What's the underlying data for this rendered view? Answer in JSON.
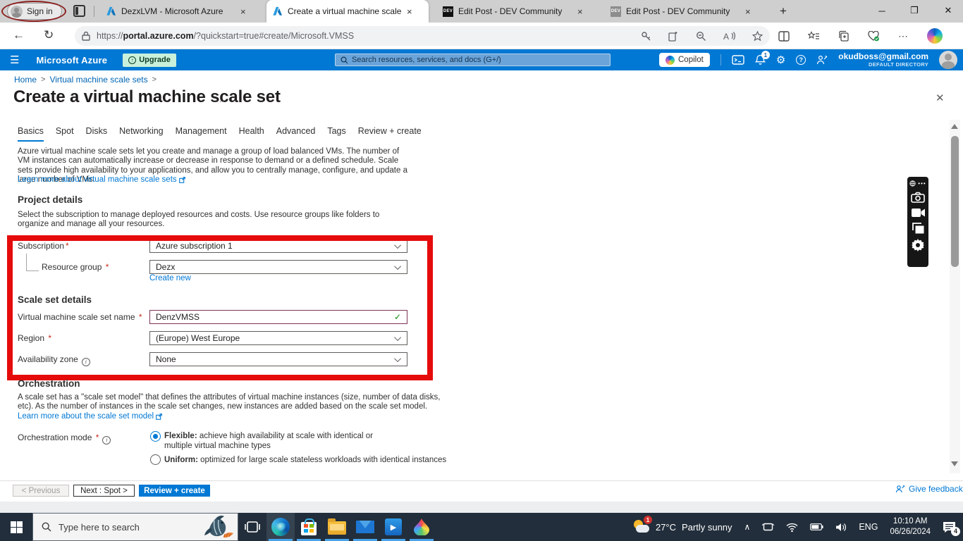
{
  "browser": {
    "sign_in_label": "Sign in",
    "tabs": [
      {
        "title": "DezxLVM - Microsoft Azure"
      },
      {
        "title": "Create a virtual machine scale se"
      },
      {
        "title": "Edit Post - DEV Community"
      },
      {
        "title": "Edit Post - DEV Community"
      }
    ],
    "dev_favicon_text": "DEV",
    "url_scheme": "https://",
    "url_host": "portal.azure.com",
    "url_path": "/?quickstart=true#create/Microsoft.VMSS"
  },
  "azure_header": {
    "brand": "Microsoft Azure",
    "upgrade_label": "Upgrade",
    "search_placeholder": "Search resources, services, and docs (G+/)",
    "copilot_label": "Copilot",
    "notification_count": "1",
    "account_email": "okudboss@gmail.com",
    "account_directory": "DEFAULT DIRECTORY"
  },
  "breadcrumb": {
    "home": "Home",
    "parent": "Virtual machine scale sets"
  },
  "page": {
    "title": "Create a virtual machine scale set",
    "tabs": [
      "Basics",
      "Spot",
      "Disks",
      "Networking",
      "Management",
      "Health",
      "Advanced",
      "Tags",
      "Review + create"
    ],
    "intro_text": "Azure virtual machine scale sets let you create and manage a group of load balanced VMs. The number of VM instances can automatically increase or decrease in response to demand or a defined schedule. Scale sets provide high availability to your applications, and allow you to centrally manage, configure, and update a large number of VMs.",
    "intro_link": "Learn more about virtual machine scale sets",
    "project_details_heading": "Project details",
    "project_details_text": "Select the subscription to manage deployed resources and costs. Use resource groups like folders to organize and manage all your resources.",
    "required_mark": "*",
    "fields": {
      "subscription_label": "Subscription",
      "subscription_value": "Azure subscription 1",
      "resource_group_label": "Resource group",
      "resource_group_value": "Dezx",
      "create_new_link": "Create new",
      "scale_set_details_heading": "Scale set details",
      "vmss_name_label": "Virtual machine scale set name",
      "vmss_name_value": "DenzVMSS",
      "region_label": "Region",
      "region_value": "(Europe) West Europe",
      "availability_zone_label": "Availability zone",
      "availability_zone_value": "None"
    },
    "orchestration_heading": "Orchestration",
    "orchestration_text": "A scale set has a \"scale set model\" that defines the attributes of virtual machine instances (size, number of data disks, etc). As the number of instances in the scale set changes, new instances are added based on the scale set model.",
    "orchestration_link": "Learn more about the scale set model",
    "orchestration_mode_label": "Orchestration mode",
    "radio_flexible_title": "Flexible:",
    "radio_flexible_desc": " achieve high availability at scale with identical or multiple virtual machine types",
    "radio_uniform_title": "Uniform:",
    "radio_uniform_desc": " optimized for large scale stateless workloads with identical instances",
    "footer": {
      "previous": "< Previous",
      "next": "Next : Spot >",
      "review": "Review + create",
      "feedback": "Give feedback"
    }
  },
  "taskbar": {
    "search_placeholder": "Type here to search",
    "weather_badge": "1",
    "weather_temp": "27°C",
    "weather_desc": "Partly sunny",
    "language": "ENG",
    "time": "10:10 AM",
    "date": "06/26/2024",
    "notification_count": "4"
  }
}
